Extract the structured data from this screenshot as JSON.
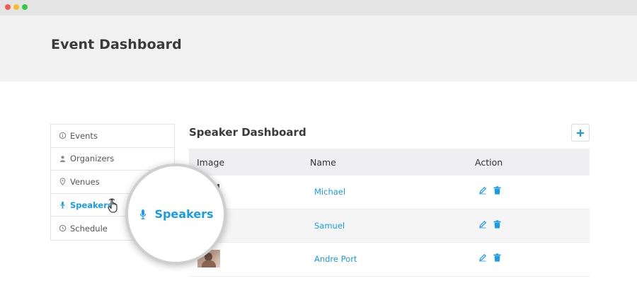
{
  "window": {
    "controls": [
      "close",
      "minimize",
      "maximize"
    ]
  },
  "header": {
    "title": "Event Dashboard"
  },
  "sidebar": {
    "items": [
      {
        "label": "Events",
        "icon": "info-icon",
        "active": false
      },
      {
        "label": "Organizers",
        "icon": "user-icon",
        "active": false
      },
      {
        "label": "Venues",
        "icon": "location-pin-icon",
        "active": false
      },
      {
        "label": "Speakers",
        "icon": "microphone-icon",
        "active": true
      },
      {
        "label": "Schedule",
        "icon": "clock-icon",
        "active": false
      }
    ]
  },
  "magnifier": {
    "label": "Speakers",
    "icon": "microphone-icon"
  },
  "main": {
    "title": "Speaker Dashboard",
    "add_icon": "plus-icon",
    "table": {
      "columns": [
        "Image",
        "Name",
        "Action"
      ],
      "rows": [
        {
          "name": "Michael",
          "has_image": false
        },
        {
          "name": "Samuel",
          "has_image": false
        },
        {
          "name": "Andre Port",
          "has_image": true
        }
      ]
    }
  },
  "colors": {
    "accent": "#1a9bea",
    "header_bg": "#f1f1f1",
    "table_head_bg": "#efeff2"
  }
}
